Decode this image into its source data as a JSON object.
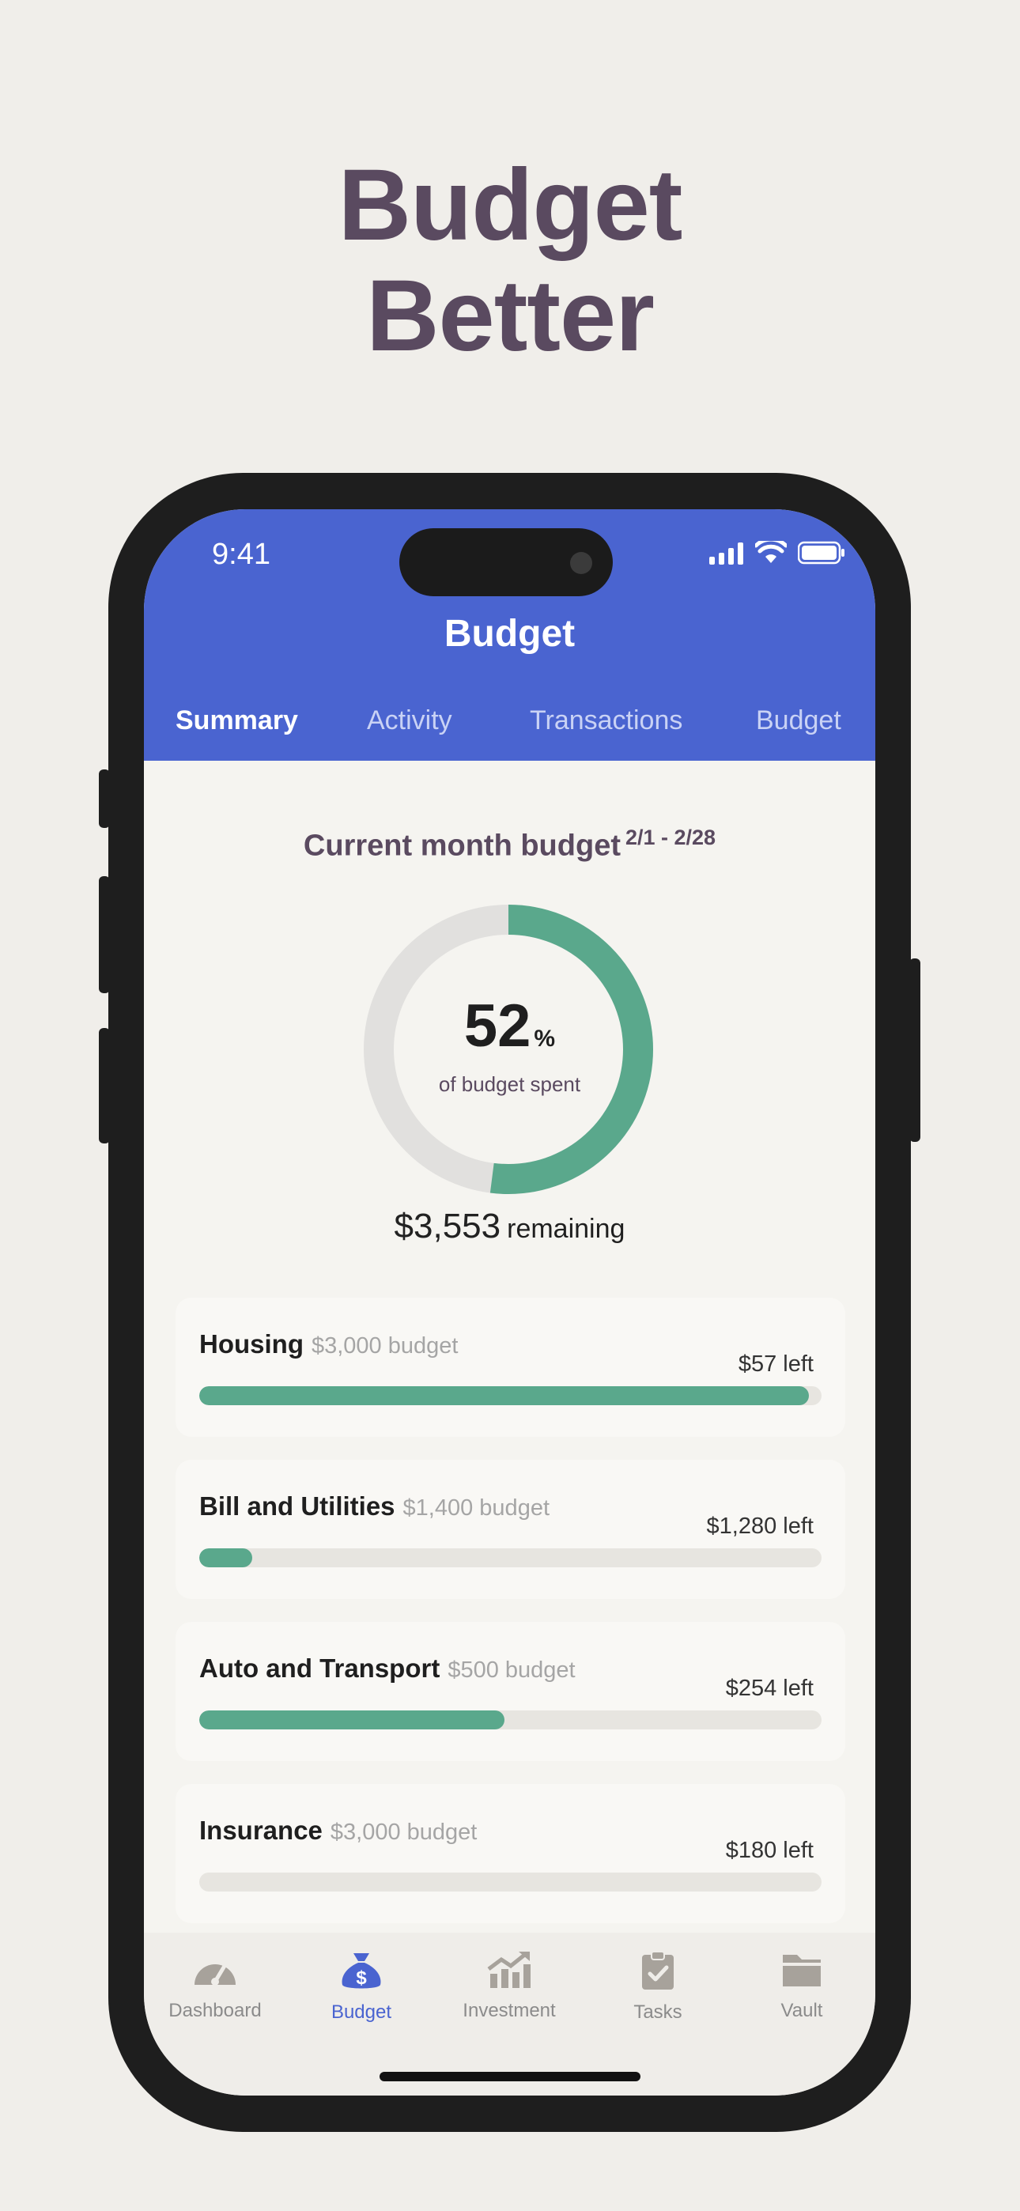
{
  "headline": {
    "line1": "Budget",
    "line2": "Better"
  },
  "status_bar": {
    "time": "9:41",
    "icons": [
      "signal-icon",
      "wifi-icon",
      "battery-icon"
    ]
  },
  "header": {
    "title": "Budget",
    "tabs": [
      {
        "label": "Summary",
        "active": true
      },
      {
        "label": "Activity",
        "active": false
      },
      {
        "label": "Transactions",
        "active": false
      },
      {
        "label": "Budget",
        "active": false
      }
    ]
  },
  "summary": {
    "title": "Current month budget",
    "date_range": "2/1 - 2/28",
    "percent_spent": 52,
    "percent_value": "52",
    "percent_symbol": "%",
    "percent_caption": "of budget spent",
    "remaining_amount": "$3,553",
    "remaining_label": "remaining"
  },
  "categories": [
    {
      "name": "Housing",
      "budget": "$3,000 budget",
      "left": "$57 left",
      "progress": 0.98
    },
    {
      "name": "Bill and Utilities",
      "budget": "$1,400 budget",
      "left": "$1,280 left",
      "progress": 0.085
    },
    {
      "name": "Auto and Transport",
      "budget": "$500 budget",
      "left": "$254 left",
      "progress": 0.49
    },
    {
      "name": "Insurance",
      "budget": "$3,000 budget",
      "left": "$180 left",
      "progress": 0.0
    }
  ],
  "tabbar": [
    {
      "label": "Dashboard",
      "icon": "gauge-icon",
      "active": false
    },
    {
      "label": "Budget",
      "icon": "money-bag-icon",
      "active": true
    },
    {
      "label": "Investment",
      "icon": "chart-up-icon",
      "active": false
    },
    {
      "label": "Tasks",
      "icon": "clipboard-check-icon",
      "active": false
    },
    {
      "label": "Vault",
      "icon": "folder-icon",
      "active": false
    }
  ],
  "colors": {
    "brand": "#4a64d0",
    "accent_green": "#5aa88c",
    "headline": "#5a4a60",
    "track": "#e7e5e0"
  }
}
